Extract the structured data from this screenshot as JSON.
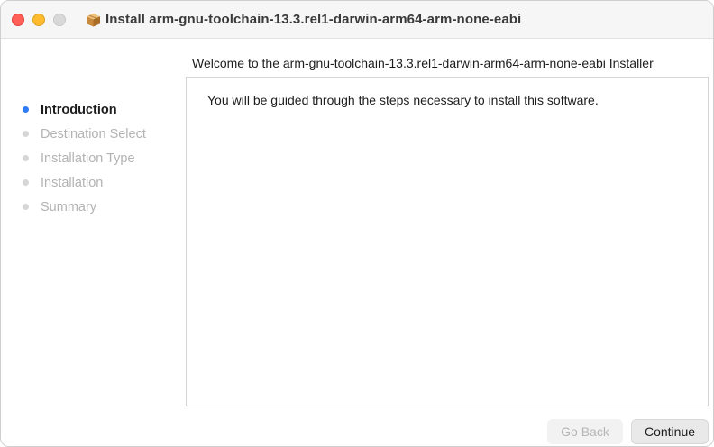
{
  "window": {
    "title": "Install arm-gnu-toolchain-13.3.rel1-darwin-arm64-arm-none-eabi",
    "icon": "package-icon",
    "controls": [
      "close",
      "minimize",
      "zoom"
    ]
  },
  "main": {
    "heading": "Welcome to the arm-gnu-toolchain-13.3.rel1-darwin-arm64-arm-none-eabi Installer",
    "body_text": "You will be guided through the steps necessary to install this software."
  },
  "sidebar": {
    "steps": [
      {
        "label": "Introduction",
        "active": true
      },
      {
        "label": "Destination Select",
        "active": false
      },
      {
        "label": "Installation Type",
        "active": false
      },
      {
        "label": "Installation",
        "active": false
      },
      {
        "label": "Summary",
        "active": false
      }
    ]
  },
  "buttons": {
    "back_label": "Go Back",
    "back_enabled": false,
    "continue_label": "Continue"
  },
  "colors": {
    "active_step": "#2f7cf6",
    "inactive_step": "#b3b3b3",
    "close": "#ff5f57",
    "minimize": "#febc2e",
    "zoom_inactive": "#d9d9d9"
  }
}
